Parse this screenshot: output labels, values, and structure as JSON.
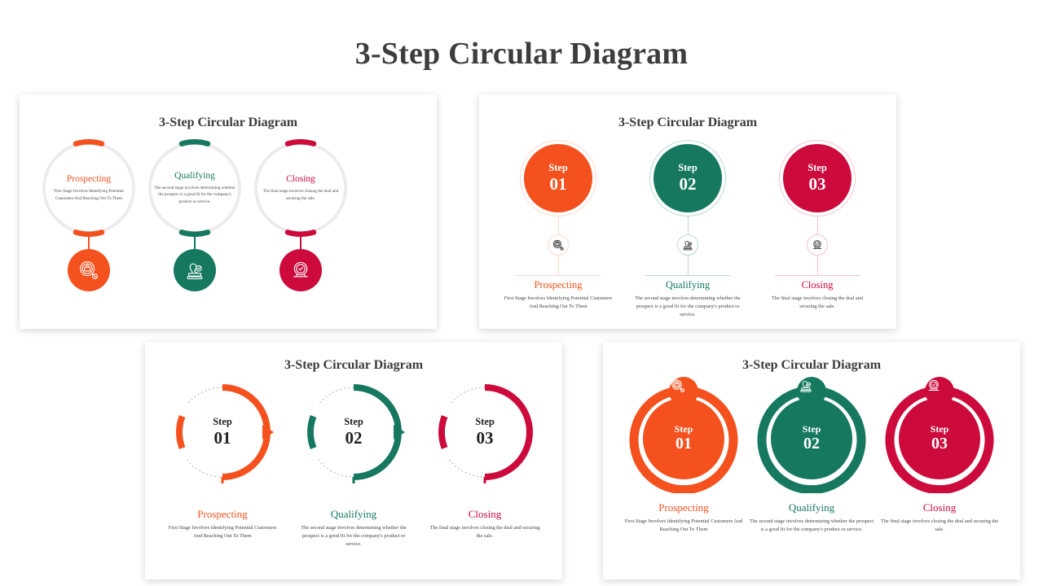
{
  "page": {
    "title": "3-Step Circular Diagram"
  },
  "colors": {
    "orange": "#F4511E",
    "green": "#15785F",
    "crimson": "#CC0A3B",
    "orange_light": "#FBDACE",
    "green_light": "#BFDAD3",
    "crimson_light": "#F2C3D0",
    "ring_gray": "#ECECEC",
    "dotted_gray": "#AFAFAF",
    "title_gray": "#3D3D3D"
  },
  "steps": [
    {
      "number": "01",
      "step_label": "Step",
      "name": "Prospecting",
      "description": "First Stage Involves Identifying Potential Customers And Reaching Out To Them",
      "color": "#F4511E",
      "color_light": "#FBDACE",
      "icon": "briefcase-search-icon"
    },
    {
      "number": "02",
      "step_label": "Step",
      "name": "Qualifying",
      "description": "The second stage involves determining whether the prospect is a good fit for the company's product or service.",
      "color": "#15785F",
      "color_light": "#BFDAD3",
      "icon": "stamp-approve-icon"
    },
    {
      "number": "03",
      "step_label": "Step",
      "name": "Closing",
      "description": "The final stage involves closing the deal and securing the sale.",
      "color": "#CC0A3B",
      "color_light": "#F2C3D0",
      "icon": "seal-check-icon"
    }
  ],
  "panels": [
    {
      "id": "panel-1",
      "title": "3-Step Circular Diagram",
      "variant": "ring-with-icon-below"
    },
    {
      "id": "panel-2",
      "title": "3-Step Circular Diagram",
      "variant": "disc-with-connector"
    },
    {
      "id": "panel-3",
      "title": "3-Step Circular Diagram",
      "variant": "open-arc-with-arrows"
    },
    {
      "id": "panel-4",
      "title": "3-Step Circular Diagram",
      "variant": "donut-with-badge"
    }
  ]
}
